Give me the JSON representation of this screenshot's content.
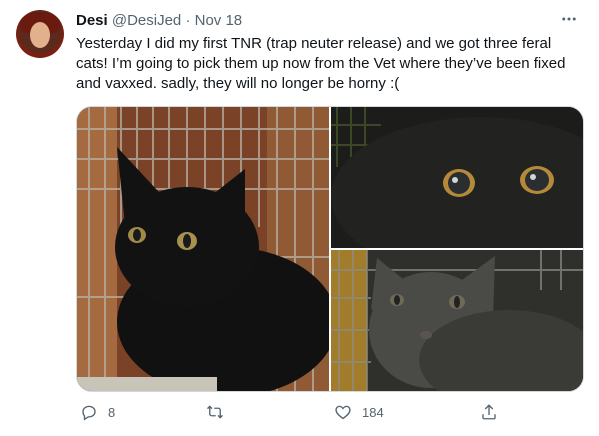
{
  "tweet": {
    "author_name": "Desi",
    "author_handle": "@DesiJed",
    "separator": "·",
    "date": "Nov 18",
    "text": "Yesterday I did my first TNR (trap neuter release) and we got three feral cats! I’m going to pick them up now from the Vet where they’ve been fixed and vaxxed.  sadly, they will no longer be horny :(",
    "media": [
      {
        "subject": "black cat in wire cage"
      },
      {
        "subject": "close-up black cat eyes"
      },
      {
        "subject": "gray cat in cage"
      }
    ],
    "actions": {
      "reply_icon": "reply-icon",
      "reply_count": "8",
      "retweet_icon": "retweet-icon",
      "retweet_count": "",
      "like_icon": "heart-icon",
      "like_count": "184",
      "share_icon": "share-icon"
    }
  },
  "colors": {
    "text_primary": "#0f1419",
    "text_secondary": "#536471",
    "border": "#cfd9de"
  }
}
